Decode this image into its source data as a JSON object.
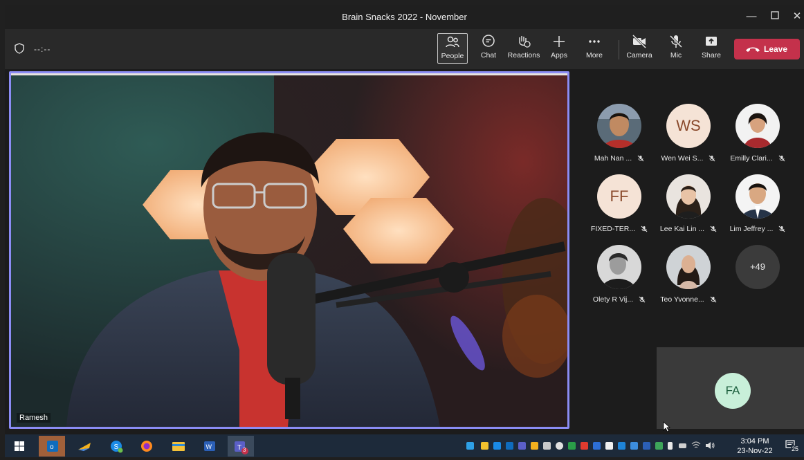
{
  "window": {
    "title": "Brain Snacks 2022 - November"
  },
  "meeting": {
    "timer": "--:--"
  },
  "toolbar": {
    "people": "People",
    "chat": "Chat",
    "reactions": "Reactions",
    "apps": "Apps",
    "more": "More",
    "camera": "Camera",
    "mic": "Mic",
    "share": "Share",
    "leave": "Leave"
  },
  "main_video": {
    "speaker_name": "Ramesh"
  },
  "participants": [
    {
      "name": "Mah Nan ...",
      "initials": "",
      "avatar": "photo"
    },
    {
      "name": "Wen Wei S...",
      "initials": "WS",
      "avatar": "initials"
    },
    {
      "name": "Emilly Clari...",
      "initials": "",
      "avatar": "photo"
    },
    {
      "name": "FIXED-TER...",
      "initials": "FF",
      "avatar": "initials"
    },
    {
      "name": "Lee Kai Lin ...",
      "initials": "",
      "avatar": "photo"
    },
    {
      "name": "Lim Jeffrey ...",
      "initials": "",
      "avatar": "photo"
    },
    {
      "name": "Olety R Vij...",
      "initials": "",
      "avatar": "photo"
    },
    {
      "name": "Teo Yvonne...",
      "initials": "",
      "avatar": "photo"
    }
  ],
  "overflow": {
    "label": "+49"
  },
  "self_view": {
    "initials": "FA"
  },
  "taskbar": {
    "time": "3:04 PM",
    "date": "23-Nov-22",
    "notification_count": "25",
    "teams_badge": "3"
  },
  "colors": {
    "accent": "#8b8cf4",
    "leave": "#c4314b",
    "taskbar": "#1d2a3a"
  }
}
